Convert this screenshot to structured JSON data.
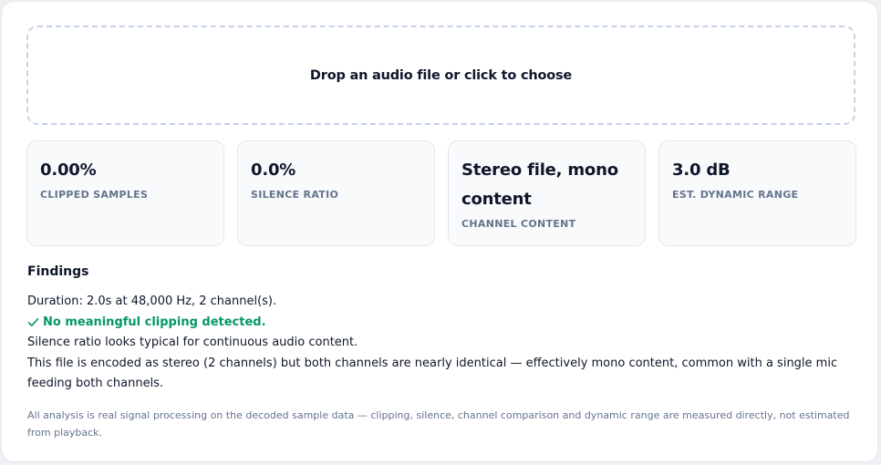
{
  "dropzone": {
    "label": "Drop an audio file or click to choose"
  },
  "stats": [
    {
      "value": "0.00%",
      "label": "CLIPPED SAMPLES"
    },
    {
      "value": "0.0%",
      "label": "SILENCE RATIO"
    },
    {
      "value": "Stereo file, mono content",
      "label": "CHANNEL CONTENT"
    },
    {
      "value": "3.0 dB",
      "label": "EST. DYNAMIC RANGE"
    }
  ],
  "findings": {
    "title": "Findings",
    "duration": "Duration: 2.0s at 48,000 Hz, 2 channel(s).",
    "clipping": "No meaningful clipping detected.",
    "silence": "Silence ratio looks typical for continuous audio content.",
    "channels": "This file is encoded as stereo (2 channels) but both channels are nearly identical — effectively mono content, common with a single mic feeding both channels."
  },
  "footnote": "All analysis is real signal processing on the decoded sample data — clipping, silence, channel comparison and dynamic range are measured directly, not estimated from playback.",
  "colors": {
    "success": "#059669",
    "muted": "#64748b",
    "dropzone_border": "#c5d3e6"
  }
}
